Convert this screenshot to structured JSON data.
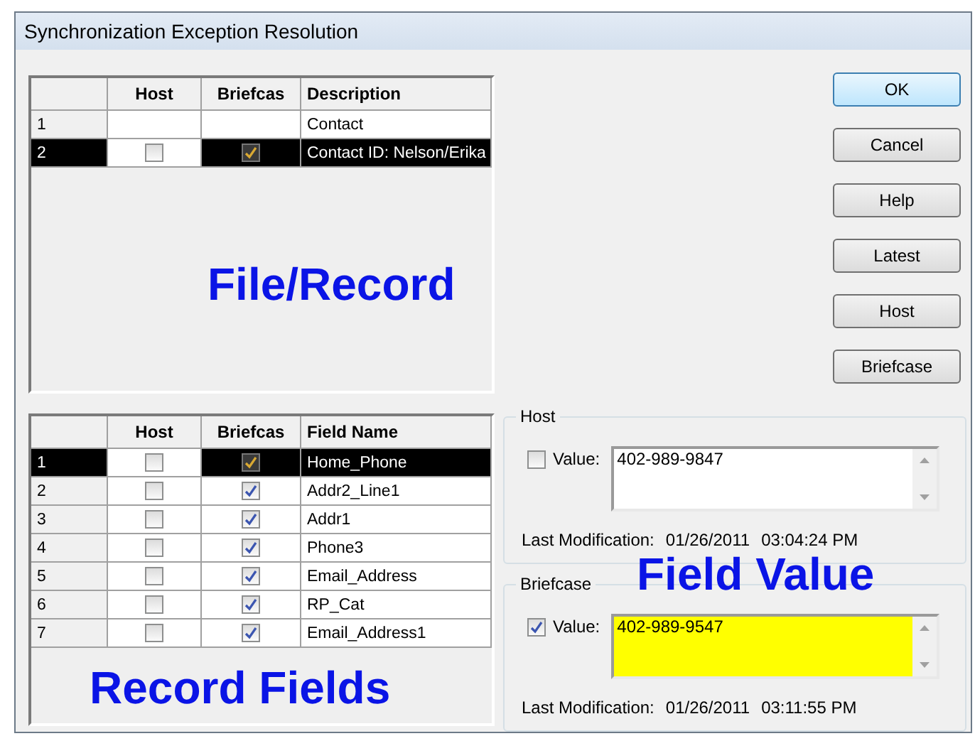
{
  "window": {
    "title": "Synchronization Exception Resolution"
  },
  "top_grid": {
    "columns": [
      "Host",
      "Briefcas",
      "Description"
    ],
    "rows": [
      {
        "number": "1",
        "description": "Contact",
        "selected": false
      },
      {
        "number": "2",
        "host": false,
        "briefcase": true,
        "description": "Contact ID: Nelson/Erika",
        "selected": true
      }
    ]
  },
  "buttons": [
    {
      "label": "OK",
      "default": true
    },
    {
      "label": "Cancel",
      "default": false
    },
    {
      "label": "Help",
      "default": false
    },
    {
      "label": "Latest",
      "default": false
    },
    {
      "label": "Host",
      "default": false
    },
    {
      "label": "Briefcase",
      "default": false
    }
  ],
  "field_grid": {
    "columns": [
      "Host",
      "Briefcas",
      "Field Name"
    ],
    "rows": [
      {
        "number": "1",
        "host": false,
        "briefcase": true,
        "description": "Home_Phone",
        "selected": true
      },
      {
        "number": "2",
        "host": false,
        "briefcase": true,
        "description": "Addr2_Line1",
        "selected": false
      },
      {
        "number": "3",
        "host": false,
        "briefcase": true,
        "description": "Addr1",
        "selected": false
      },
      {
        "number": "4",
        "host": false,
        "briefcase": true,
        "description": "Phone3",
        "selected": false
      },
      {
        "number": "5",
        "host": false,
        "briefcase": true,
        "description": "Email_Address",
        "selected": false
      },
      {
        "number": "6",
        "host": false,
        "briefcase": true,
        "description": "RP_Cat",
        "selected": false
      },
      {
        "number": "7",
        "host": false,
        "briefcase": true,
        "description": "Email_Address1",
        "selected": false
      }
    ]
  },
  "groups": [
    {
      "title": "Host",
      "checkbox_label": "Value:",
      "checked": false,
      "value": "402-989-9847",
      "highlighted": false,
      "modified_label": "Last Modification:",
      "date": "01/26/2011",
      "time": "03:04:24 PM"
    },
    {
      "title": "Briefcase",
      "checkbox_label": "Value:",
      "checked": true,
      "value": "402-989-9547",
      "highlighted": true,
      "modified_label": "Last Modification:",
      "date": "01/26/2011",
      "time": "03:11:55 PM"
    }
  ],
  "annotations": [
    {
      "text": "File/Record"
    },
    {
      "text": "Record Fields"
    },
    {
      "text": "Field Value"
    }
  ]
}
